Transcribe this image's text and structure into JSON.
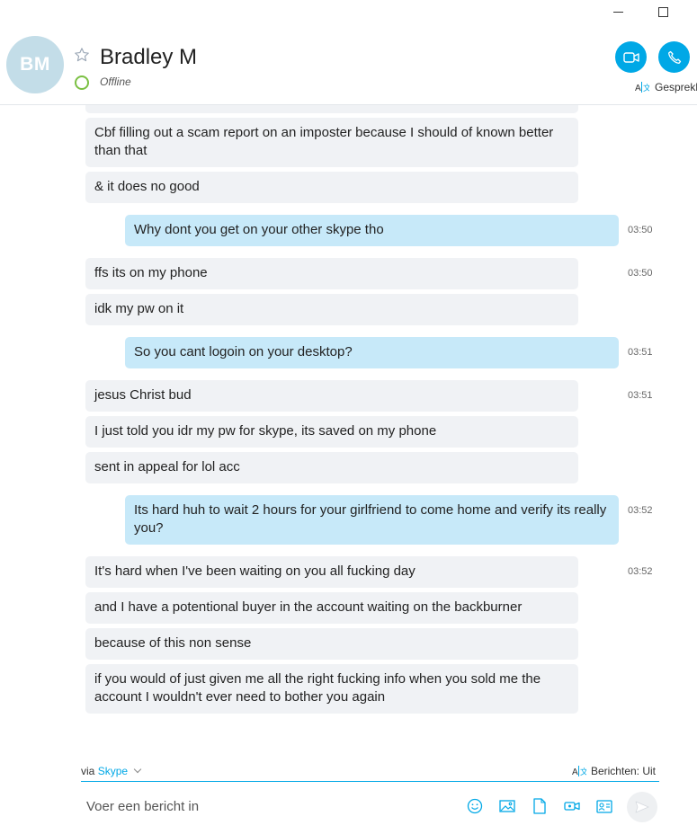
{
  "window": {
    "minimize_icon": "minimize-icon",
    "maximize_icon": "maximize-icon"
  },
  "header": {
    "avatar_initials": "BM",
    "contact_name": "Bradley M",
    "presence": "Offline",
    "translate_label": "Gesprekl",
    "colors": {
      "accent": "#00a8e6",
      "presence": "#7bc043",
      "avatar_bg": "#c3dde8"
    }
  },
  "messages": [
    {
      "dir": "in",
      "text": "Cbf filling out a scam report on an imposter because I should of known better than that",
      "time": ""
    },
    {
      "dir": "in",
      "text": "& it does no good",
      "time": ""
    },
    {
      "dir": "out",
      "text": "Why dont you get on your other skype tho",
      "time": "03:50"
    },
    {
      "dir": "in",
      "text": "ffs its on my phone",
      "time": "03:50"
    },
    {
      "dir": "in",
      "text": "idk my pw on it",
      "time": ""
    },
    {
      "dir": "out",
      "text": "So you cant logoin on your desktop?",
      "time": "03:51"
    },
    {
      "dir": "in",
      "text": "jesus Christ bud",
      "time": "03:51"
    },
    {
      "dir": "in",
      "text": "I just told you idr my pw for skype, its saved on my phone",
      "time": ""
    },
    {
      "dir": "in",
      "text": "sent in appeal for lol acc",
      "time": ""
    },
    {
      "dir": "out",
      "text": "Its hard huh to wait 2 hours for your girlfriend to come home and verify its really you?",
      "time": "03:52"
    },
    {
      "dir": "in",
      "text": "It's hard when I've been waiting on you all fucking day",
      "time": "03:52"
    },
    {
      "dir": "in",
      "text": "and I have a potentional buyer in the account waiting on the backburner",
      "time": ""
    },
    {
      "dir": "in",
      "text": "because of this non sense",
      "time": ""
    },
    {
      "dir": "in",
      "text": "if you would of just given me all the right fucking info when you sold me the account I wouldn't ever need to bother you again",
      "time": ""
    }
  ],
  "composer": {
    "via_prefix": "via",
    "via_service": "Skype",
    "translation_status": "Berichten: Uit",
    "placeholder": "Voer een bericht in",
    "tools": [
      "emoticon-icon",
      "image-icon",
      "file-icon",
      "video-message-icon",
      "contact-card-icon"
    ],
    "send_icon": "send-icon"
  }
}
